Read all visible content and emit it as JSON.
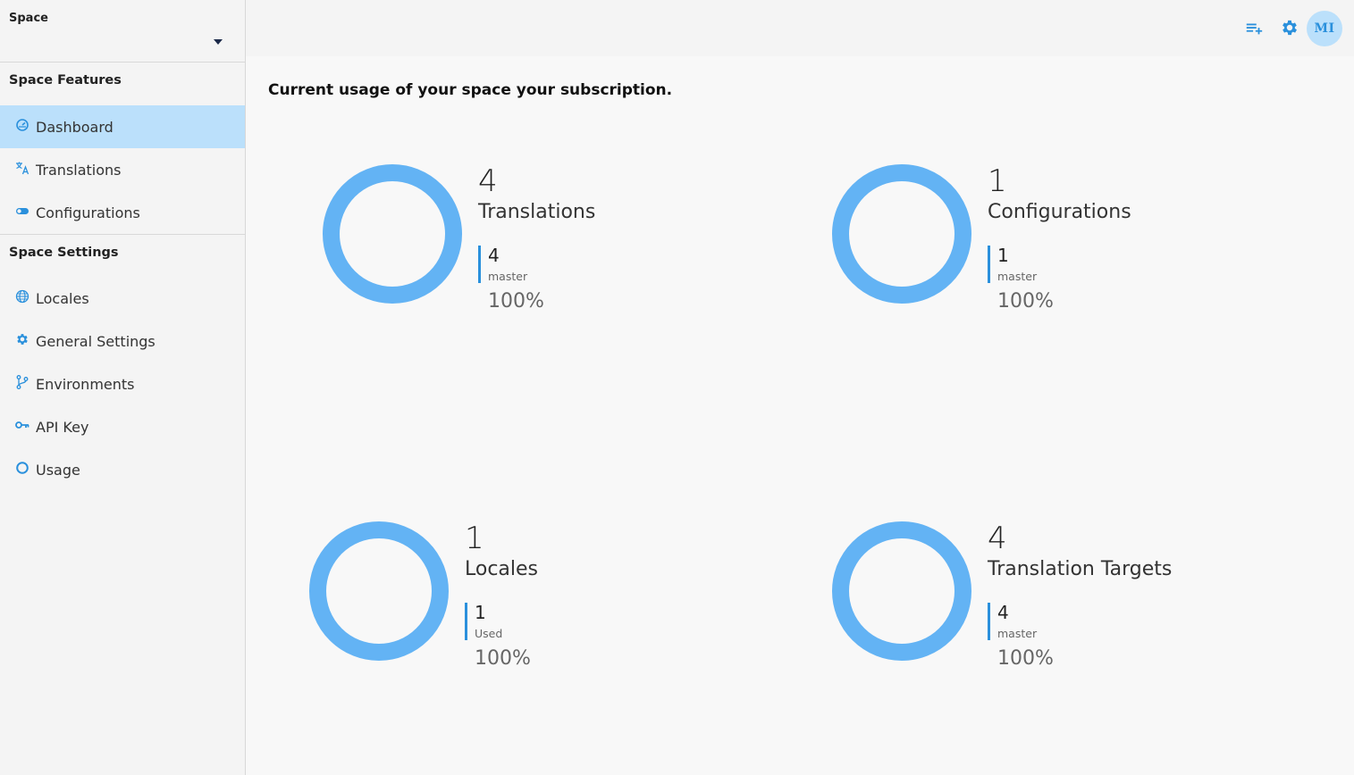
{
  "sidebar": {
    "space_label": "Space",
    "features_title": "Space Features",
    "features": [
      {
        "label": "Dashboard",
        "icon": "dashboard-icon",
        "active": true
      },
      {
        "label": "Translations",
        "icon": "translate-icon",
        "active": false
      },
      {
        "label": "Configurations",
        "icon": "toggle-icon",
        "active": false
      }
    ],
    "settings_title": "Space Settings",
    "settings": [
      {
        "label": "Locales",
        "icon": "globe-icon"
      },
      {
        "label": "General Settings",
        "icon": "gear-icon"
      },
      {
        "label": "Environments",
        "icon": "branch-icon"
      },
      {
        "label": "API Key",
        "icon": "key-icon"
      },
      {
        "label": "Usage",
        "icon": "usage-circle-icon"
      }
    ]
  },
  "topbar": {
    "avatar_initials": "MI"
  },
  "main": {
    "heading": "Current usage of your space your subscription.",
    "cards": [
      {
        "count": "4",
        "title": "Translations",
        "sub_count": "4",
        "sub_label": "master",
        "percent": "100%"
      },
      {
        "count": "1",
        "title": "Configurations",
        "sub_count": "1",
        "sub_label": "master",
        "percent": "100%"
      },
      {
        "count": "1",
        "title": "Locales",
        "sub_count": "1",
        "sub_label": "Used",
        "percent": "100%"
      },
      {
        "count": "4",
        "title": "Translation Targets",
        "sub_count": "4",
        "sub_label": "master",
        "percent": "100%"
      }
    ]
  },
  "colors": {
    "accent": "#2a90dc",
    "ring": "#63b3f4",
    "active_bg": "#bbe0fb"
  }
}
